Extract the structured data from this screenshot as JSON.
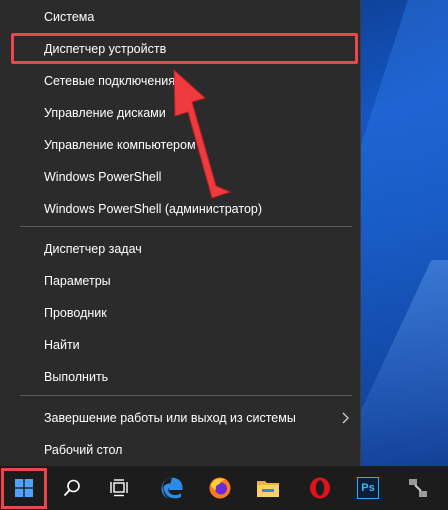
{
  "menu": {
    "items": [
      {
        "label": "Система"
      },
      {
        "label": "Диспетчер устройств"
      },
      {
        "label": "Сетевые подключения"
      },
      {
        "label": "Управление дисками"
      },
      {
        "label": "Управление компьютером"
      },
      {
        "label": "Windows PowerShell"
      },
      {
        "label": "Windows PowerShell (администратор)"
      },
      {
        "label": "Диспетчер задач"
      },
      {
        "label": "Параметры"
      },
      {
        "label": "Проводник"
      },
      {
        "label": "Найти"
      },
      {
        "label": "Выполнить"
      },
      {
        "label": "Завершение работы или выход из системы"
      },
      {
        "label": "Рабочий стол"
      }
    ]
  },
  "taskbar": {
    "ps_label": "Ps"
  },
  "colors": {
    "menu_bg": "#2b2b2b",
    "highlight": "#e8484d",
    "taskbar_bg": "#1c1c1c"
  }
}
